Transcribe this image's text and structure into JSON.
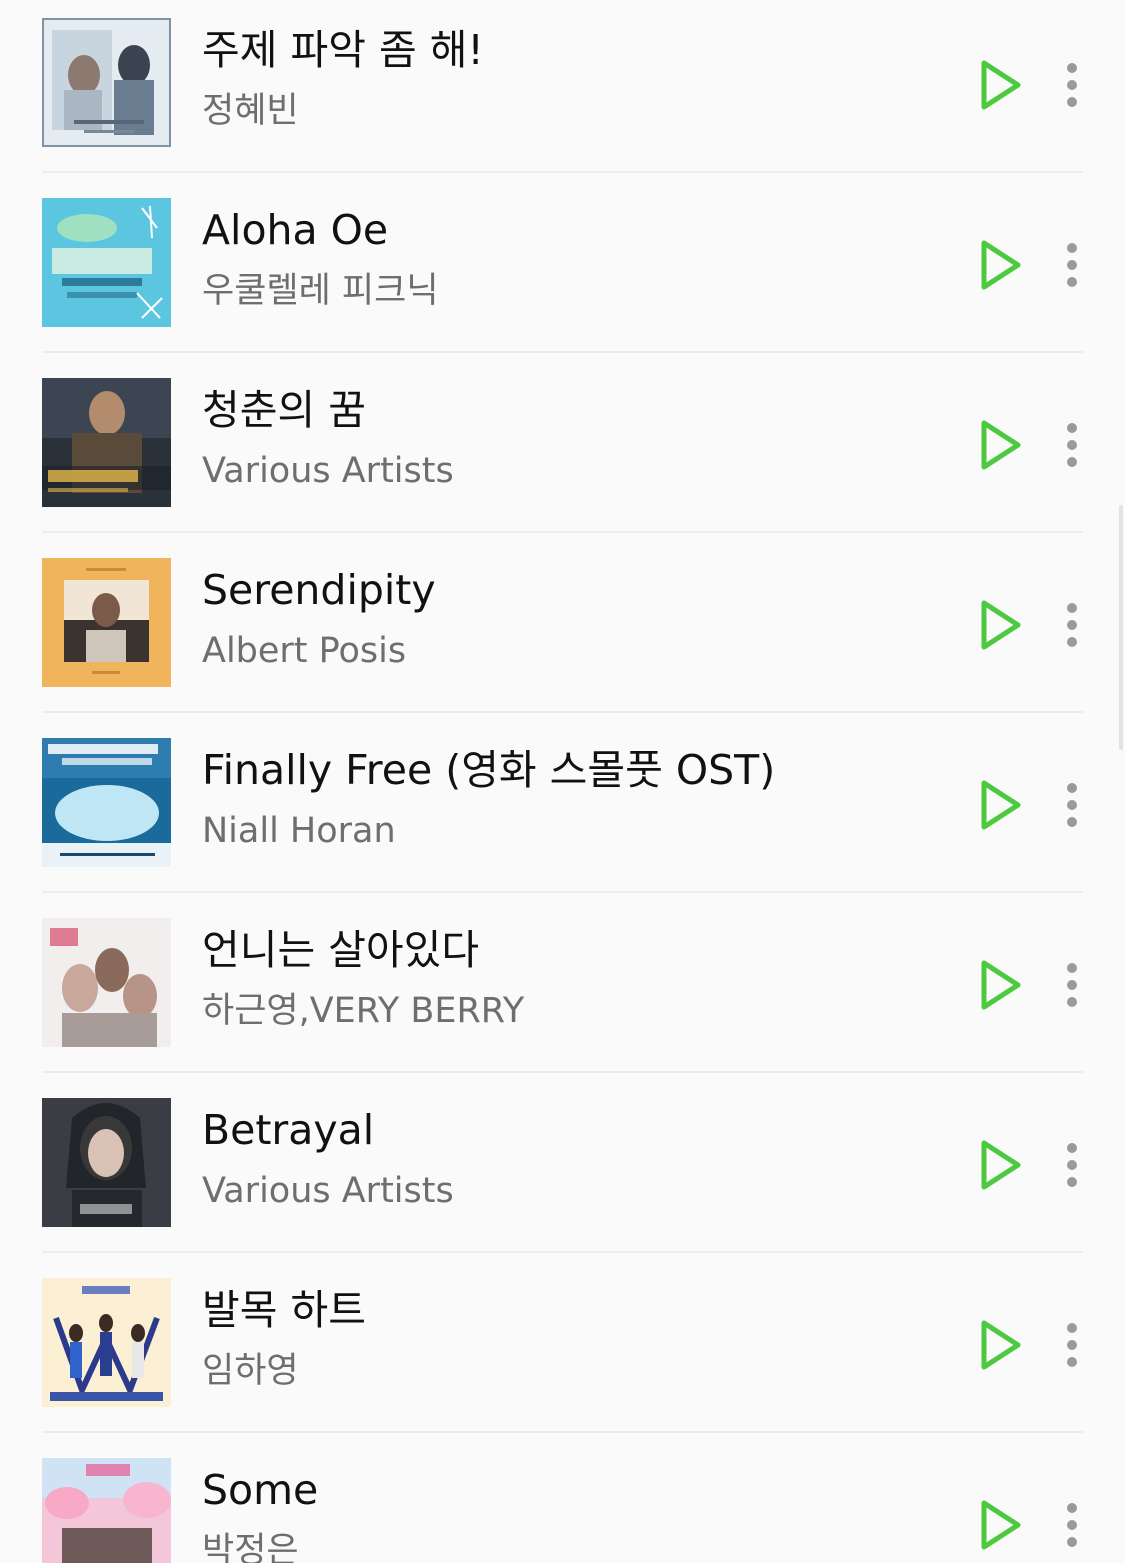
{
  "songs": [
    {
      "title": "주제 파악 좀 해!",
      "artist": "정혜빈",
      "cover_icon": "album-art-melt-me-ost"
    },
    {
      "title": "Aloha Oe",
      "artist": "우쿨렐레 피크닉",
      "cover_icon": "album-art-ukulele-picnic"
    },
    {
      "title": "청춘의 꿈",
      "artist": "Various Artists",
      "cover_icon": "album-art-soundtrack"
    },
    {
      "title": "Serendipity",
      "artist": "Albert Posis",
      "cover_icon": "album-art-albert-posis"
    },
    {
      "title": "Finally Free (영화 스몰풋 OST)",
      "artist": "Niall Horan",
      "cover_icon": "album-art-smallfoot"
    },
    {
      "title": "언니는 살아있다",
      "artist": "하근영,VERY BERRY",
      "cover_icon": "album-art-drama-ost"
    },
    {
      "title": "Betrayal",
      "artist": "Various Artists",
      "cover_icon": "album-art-dark-portrait"
    },
    {
      "title": "발목 하트",
      "artist": "임하영",
      "cover_icon": "album-art-www-ost"
    },
    {
      "title": "Some",
      "artist": "박정은",
      "cover_icon": "album-art-group-photo"
    }
  ],
  "colors": {
    "play_accent": "#4cc93f",
    "more_dots": "#9a9a9a",
    "title_text": "#111111",
    "artist_text": "#6e6e6e"
  },
  "icons": {
    "play": "play-icon",
    "more": "more-vertical-icon"
  }
}
